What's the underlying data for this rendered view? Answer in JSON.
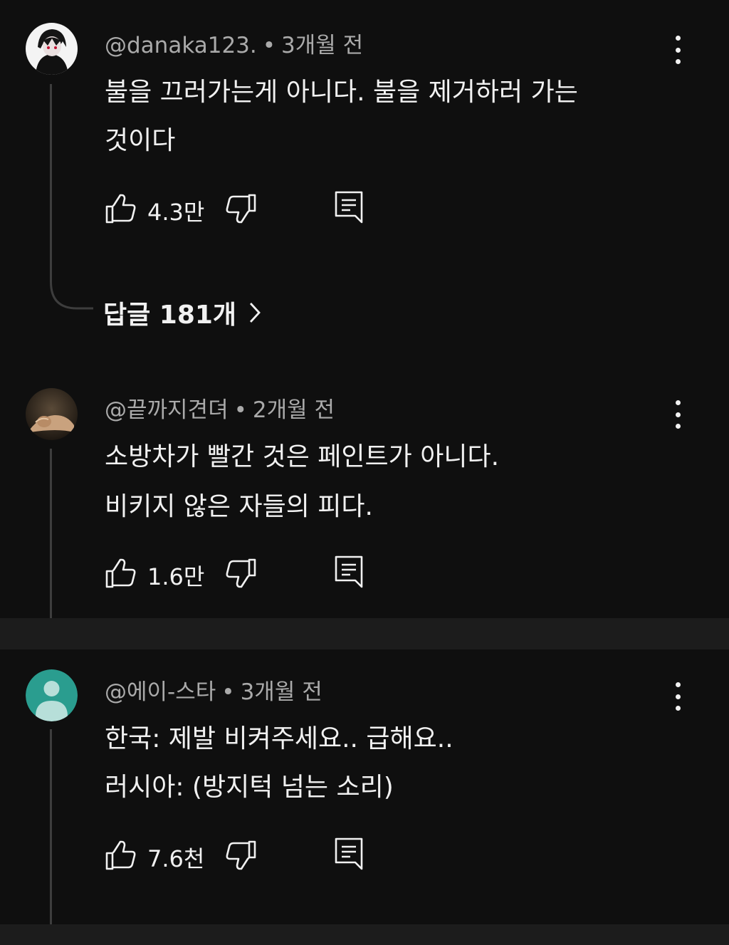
{
  "comments": [
    {
      "author": "@danaka123.",
      "separator": "•",
      "time": "3개월 전",
      "lines": [
        "불을 끄러가는게 아니다. 불을 제거하러 가는",
        "것이다"
      ],
      "likes": "4.3만",
      "replies_label": "답글 181개"
    },
    {
      "author": "@끝까지견뎌",
      "separator": "•",
      "time": "2개월 전",
      "lines": [
        "소방차가 빨간 것은 페인트가 아니다.",
        "비키지 않은 자들의 피다."
      ],
      "likes": "1.6만"
    },
    {
      "author": "@에이-스타",
      "separator": "•",
      "time": "3개월 전",
      "lines": [
        "한국: 제발 비켜주세요.. 급해요..",
        "러시아: (방지턱 넘는 소리)"
      ],
      "likes": "7.6천"
    }
  ],
  "icons": {
    "like": "thumbs-up-icon",
    "dislike": "thumbs-down-icon",
    "reply": "reply-icon",
    "more": "more-vert-icon",
    "chevron": "chevron-right-icon"
  },
  "colors": {
    "background": "#0f0f0f",
    "divider": "#1c1c1c",
    "text": "#f1f1f1",
    "meta": "#aaaaaa",
    "default_avatar": "#2a9d8f"
  }
}
